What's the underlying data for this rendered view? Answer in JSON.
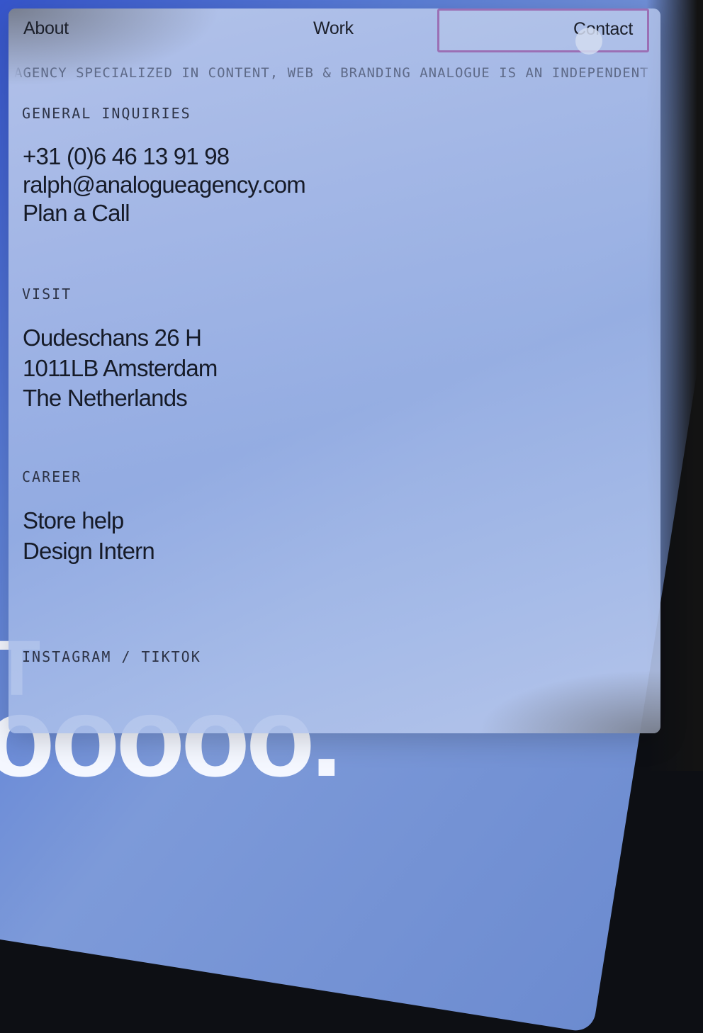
{
  "nav": {
    "about": "About",
    "work": "Work",
    "contact": "Contact"
  },
  "ticker": "AGENCY SPECIALIZED IN CONTENT, WEB & BRANDING ANALOGUE IS AN INDEPENDENT",
  "sections": {
    "general": {
      "label": "GENERAL INQUIRIES",
      "phone": "+31 (0)6 46 13 91 98",
      "email": "ralph@analogueagency.com",
      "call": "Plan a Call"
    },
    "visit": {
      "label": "VISIT",
      "line1": "Oudeschans 26 H",
      "line2": "1011LB Amsterdam",
      "line3": "The Netherlands"
    },
    "career": {
      "label": "CAREER",
      "job1": "Store help",
      "job2": "Design Intern"
    },
    "social": {
      "label": "INSTAGRAM / TIKTOK"
    }
  }
}
